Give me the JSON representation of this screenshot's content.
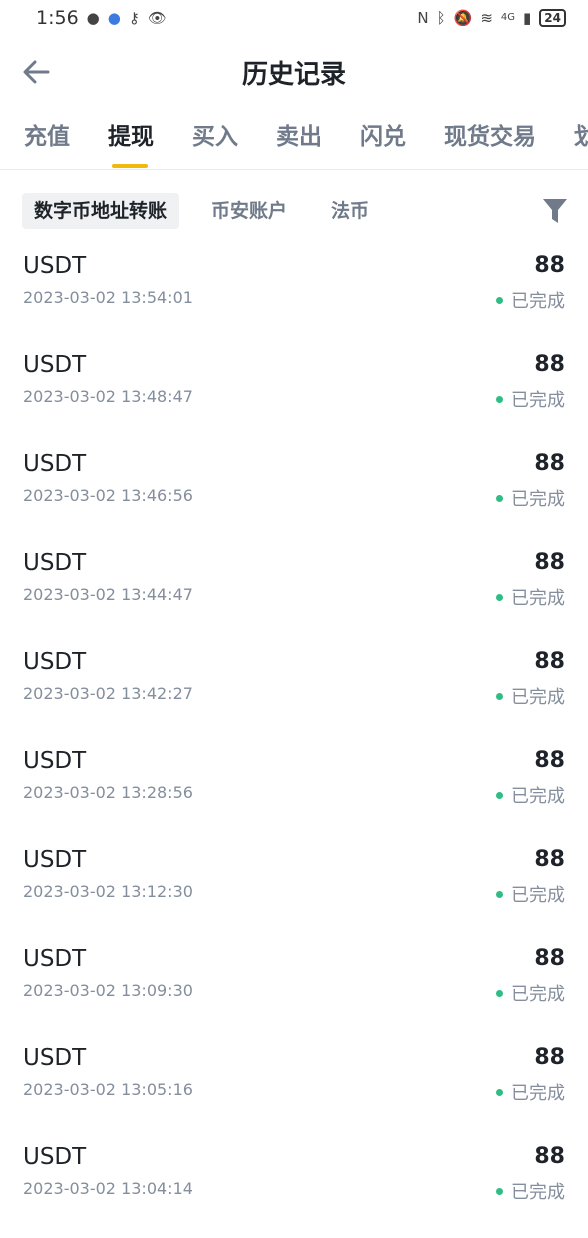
{
  "status_bar": {
    "time": "1:56",
    "network": "4G",
    "battery": "24"
  },
  "header": {
    "title": "历史记录"
  },
  "tabs": [
    {
      "label": "充值"
    },
    {
      "label": "提现"
    },
    {
      "label": "买入"
    },
    {
      "label": "卖出"
    },
    {
      "label": "闪兑"
    },
    {
      "label": "现货交易"
    },
    {
      "label": "划"
    }
  ],
  "subtabs": [
    {
      "label": "数字币地址转账"
    },
    {
      "label": "币安账户"
    },
    {
      "label": "法币"
    }
  ],
  "records": [
    {
      "coin": "USDT",
      "time": "2023-03-02 13:54:01",
      "amount": "88",
      "status": "已完成"
    },
    {
      "coin": "USDT",
      "time": "2023-03-02 13:48:47",
      "amount": "88",
      "status": "已完成"
    },
    {
      "coin": "USDT",
      "time": "2023-03-02 13:46:56",
      "amount": "88",
      "status": "已完成"
    },
    {
      "coin": "USDT",
      "time": "2023-03-02 13:44:47",
      "amount": "88",
      "status": "已完成"
    },
    {
      "coin": "USDT",
      "time": "2023-03-02 13:42:27",
      "amount": "88",
      "status": "已完成"
    },
    {
      "coin": "USDT",
      "time": "2023-03-02 13:28:56",
      "amount": "88",
      "status": "已完成"
    },
    {
      "coin": "USDT",
      "time": "2023-03-02 13:12:30",
      "amount": "88",
      "status": "已完成"
    },
    {
      "coin": "USDT",
      "time": "2023-03-02 13:09:30",
      "amount": "88",
      "status": "已完成"
    },
    {
      "coin": "USDT",
      "time": "2023-03-02 13:05:16",
      "amount": "88",
      "status": "已完成"
    },
    {
      "coin": "USDT",
      "time": "2023-03-02 13:04:14",
      "amount": "88",
      "status": "已完成"
    }
  ],
  "colors": {
    "accent": "#f0b90b",
    "status_success": "#2ebd85",
    "text_primary": "#1e2329",
    "text_secondary": "#848e9c"
  }
}
